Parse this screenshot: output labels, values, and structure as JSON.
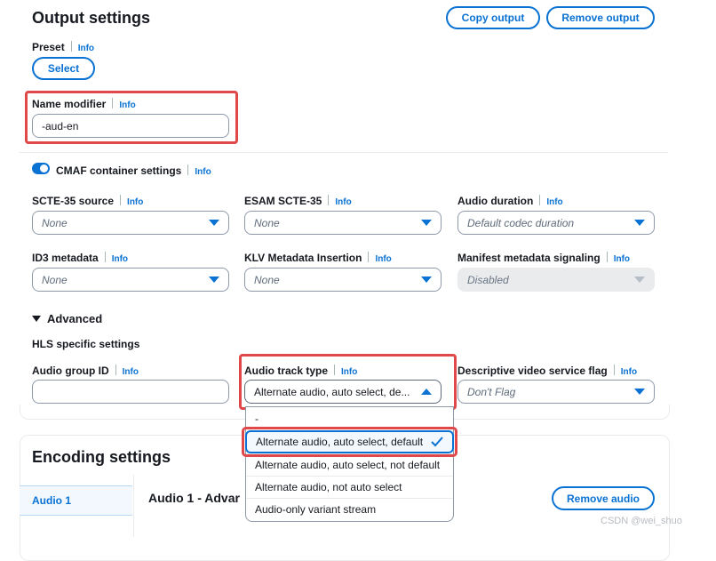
{
  "output": {
    "title": "Output settings",
    "copy_btn": "Copy output",
    "remove_btn": "Remove output"
  },
  "preset": {
    "label": "Preset",
    "info": "Info",
    "button": "Select"
  },
  "name_modifier": {
    "label": "Name modifier",
    "info": "Info",
    "value": "-aud-en"
  },
  "cmaf": {
    "label": "CMAF container settings",
    "info": "Info",
    "enabled": true
  },
  "fields": {
    "scte35": {
      "label": "SCTE-35 source",
      "info": "Info",
      "value": "None"
    },
    "esam": {
      "label": "ESAM SCTE-35",
      "info": "Info",
      "value": "None"
    },
    "audio_duration": {
      "label": "Audio duration",
      "info": "Info",
      "value": "Default codec duration"
    },
    "id3": {
      "label": "ID3 metadata",
      "info": "Info",
      "value": "None"
    },
    "klv": {
      "label": "KLV Metadata Insertion",
      "info": "Info",
      "value": "None"
    },
    "manifest": {
      "label": "Manifest metadata signaling",
      "info": "Info",
      "value": "Disabled"
    }
  },
  "advanced": {
    "label": "Advanced",
    "hls_heading": "HLS specific settings"
  },
  "hls": {
    "audio_group": {
      "label": "Audio group ID",
      "info": "Info",
      "value": ""
    },
    "audio_track": {
      "label": "Audio track type",
      "info": "Info",
      "value": "Alternate audio, auto select, de..."
    },
    "dvs_flag": {
      "label": "Descriptive video service flag",
      "info": "Info",
      "value": "Don't Flag"
    }
  },
  "dropdown": {
    "options": [
      "-",
      "Alternate audio, auto select, default",
      "Alternate audio, auto select, not default",
      "Alternate audio, not auto select",
      "Audio-only variant stream"
    ],
    "selected_index": 1
  },
  "encoding": {
    "title": "Encoding settings",
    "tab": "Audio 1",
    "panel_title": "Audio 1 - Advar",
    "remove_audio": "Remove audio"
  },
  "watermark": "CSDN @wei_shuo",
  "colors": {
    "accent": "#0972d3",
    "highlight": "#e0484a"
  }
}
